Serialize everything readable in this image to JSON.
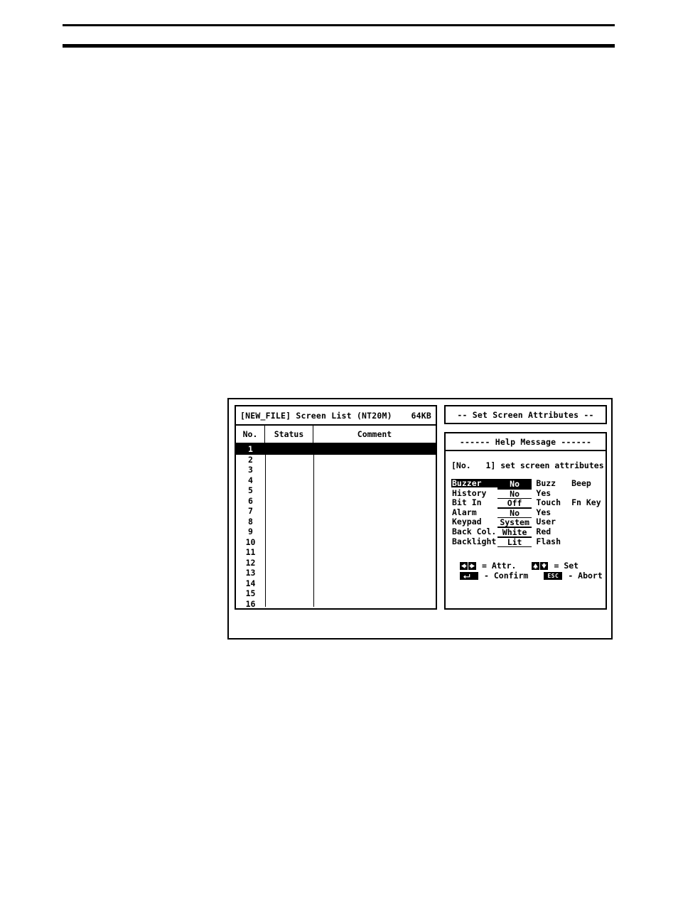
{
  "page": {
    "rules": [
      "top-rule",
      "bottom-rule"
    ]
  },
  "screen_list": {
    "title": "[NEW_FILE]  Screen List (NT20M)",
    "memory_size": "64KB",
    "columns": [
      "No.",
      "Status",
      "Comment"
    ],
    "rows": [
      {
        "no": "1",
        "status": "",
        "comment": "",
        "selected": true
      },
      {
        "no": "2",
        "status": "",
        "comment": "",
        "selected": false
      },
      {
        "no": "3",
        "status": "",
        "comment": "",
        "selected": false
      },
      {
        "no": "4",
        "status": "",
        "comment": "",
        "selected": false
      },
      {
        "no": "5",
        "status": "",
        "comment": "",
        "selected": false
      },
      {
        "no": "6",
        "status": "",
        "comment": "",
        "selected": false
      },
      {
        "no": "7",
        "status": "",
        "comment": "",
        "selected": false
      },
      {
        "no": "8",
        "status": "",
        "comment": "",
        "selected": false
      },
      {
        "no": "9",
        "status": "",
        "comment": "",
        "selected": false
      },
      {
        "no": "10",
        "status": "",
        "comment": "",
        "selected": false
      },
      {
        "no": "11",
        "status": "",
        "comment": "",
        "selected": false
      },
      {
        "no": "12",
        "status": "",
        "comment": "",
        "selected": false
      },
      {
        "no": "13",
        "status": "",
        "comment": "",
        "selected": false
      },
      {
        "no": "14",
        "status": "",
        "comment": "",
        "selected": false
      },
      {
        "no": "15",
        "status": "",
        "comment": "",
        "selected": false
      },
      {
        "no": "16",
        "status": "",
        "comment": "",
        "selected": false
      }
    ]
  },
  "attributes_panel": {
    "title": "--  Set Screen Attributes  --",
    "help_title": "------   Help Message   ------",
    "screen_line": "[No.   1] set screen attributes",
    "rows": [
      {
        "label": "Buzzer",
        "value": "No",
        "label_inverse": true,
        "value_inverse": true,
        "options": [
          "Buzz",
          "Beep"
        ]
      },
      {
        "label": "History",
        "value": "No",
        "label_inverse": false,
        "value_inverse": false,
        "options": [
          "Yes",
          ""
        ]
      },
      {
        "label": "Bit In",
        "value": "Off",
        "label_inverse": false,
        "value_inverse": false,
        "options": [
          "Touch",
          "Fn Key"
        ]
      },
      {
        "label": "Alarm",
        "value": "No",
        "label_inverse": false,
        "value_inverse": false,
        "options": [
          "Yes",
          ""
        ]
      },
      {
        "label": "Keypad",
        "value": "System",
        "label_inverse": false,
        "value_inverse": false,
        "options": [
          "User",
          ""
        ]
      },
      {
        "label": "Back Col.",
        "value": "White",
        "label_inverse": false,
        "value_inverse": false,
        "options": [
          "Red",
          ""
        ]
      },
      {
        "label": "Backlight",
        "value": "Lit",
        "label_inverse": false,
        "value_inverse": false,
        "options": [
          "Flash",
          ""
        ]
      }
    ],
    "legend": [
      {
        "keys": [
          "left-arrow-key",
          "right-arrow-key"
        ],
        "separator": "=",
        "action": "Attr."
      },
      {
        "keys": [
          "enter-key"
        ],
        "separator": "-",
        "action": "Confirm"
      },
      {
        "keys": [
          "up-arrow-key",
          "down-arrow-key"
        ],
        "separator": "=",
        "action": "Set"
      },
      {
        "keys": [
          "esc-key"
        ],
        "separator": "-",
        "action": "Abort"
      }
    ],
    "legend_labels": {
      "attr": "= Attr.",
      "confirm": "- Confirm",
      "set": "= Set",
      "abort": "- Abort",
      "esc_cap": "ESC"
    }
  },
  "colors": {
    "foreground": "#000000",
    "background": "#ffffff"
  }
}
